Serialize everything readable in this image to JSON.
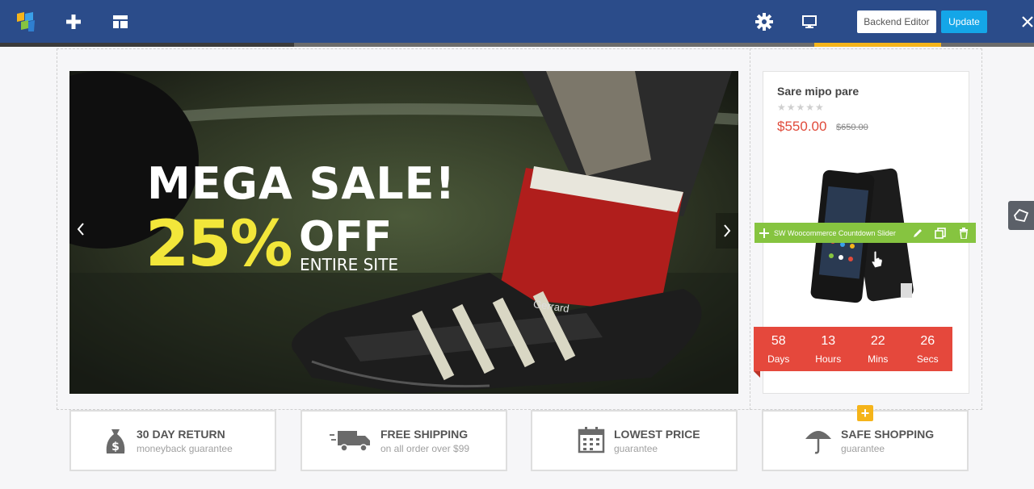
{
  "toolbar": {
    "backend_label": "Backend Editor",
    "update_label": "Update"
  },
  "slider": {
    "title": "MEGA SALE!",
    "percent": "25%",
    "off": "OFF",
    "subtitle": "ENTIRE SITE",
    "shoe_text": "Gerrard"
  },
  "product": {
    "name": "Sare mipo pare",
    "stars": "★★★★★",
    "price": "$550.00",
    "old_price": "$650.00"
  },
  "element_bar": {
    "label": "SW Woocommerce Countdown Slider"
  },
  "countdown": [
    {
      "value": "58",
      "label": "Days"
    },
    {
      "value": "13",
      "label": "Hours"
    },
    {
      "value": "22",
      "label": "Mins"
    },
    {
      "value": "26",
      "label": "Secs"
    }
  ],
  "features": [
    {
      "title": "30 DAY RETURN",
      "subtitle": "moneyback guarantee",
      "icon": "money-bag-icon"
    },
    {
      "title": "FREE SHIPPING",
      "subtitle": "on all order over $99",
      "icon": "truck-icon"
    },
    {
      "title": "LOWEST PRICE",
      "subtitle": "guarantee",
      "icon": "calendar-icon"
    },
    {
      "title": "SAFE SHOPPING",
      "subtitle": "guarantee",
      "icon": "umbrella-icon"
    }
  ],
  "colors": {
    "topbar": "#2b4c8a",
    "update_button": "#14a6e8",
    "sale_yellow": "#f2e63a",
    "price_red": "#e04b3b",
    "countdown_red": "#e5483c",
    "element_bar_green": "#86c440",
    "accent_yellow": "#f5b41a"
  }
}
